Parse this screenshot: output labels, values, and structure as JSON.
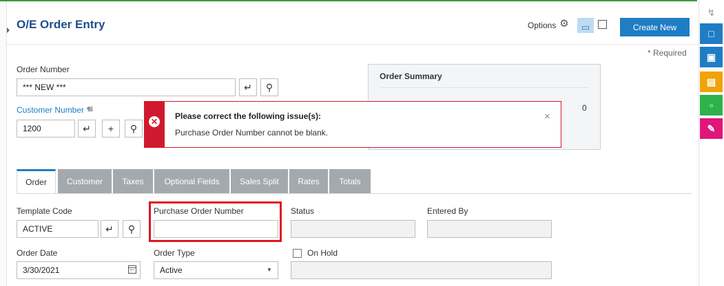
{
  "header": {
    "title": "O/E Order Entry",
    "options_label": "Options",
    "create_new_label": "Create New",
    "required_text": "Required"
  },
  "order_number": {
    "label": "Order Number",
    "value": "*** NEW ***"
  },
  "customer_number": {
    "label": "Customer Number",
    "value": "1200"
  },
  "order_summary": {
    "title": "Order Summary",
    "value": "0"
  },
  "alert": {
    "title": "Please correct the following issue(s):",
    "message": "Purchase Order Number cannot be blank."
  },
  "tabs": [
    {
      "label": "Order",
      "active": true
    },
    {
      "label": "Customer"
    },
    {
      "label": "Taxes"
    },
    {
      "label": "Optional Fields"
    },
    {
      "label": "Sales Split"
    },
    {
      "label": "Rates"
    },
    {
      "label": "Totals"
    }
  ],
  "form": {
    "template_code": {
      "label": "Template Code",
      "value": "ACTIVE"
    },
    "purchase_order_number": {
      "label": "Purchase Order Number",
      "value": ""
    },
    "status": {
      "label": "Status",
      "value": ""
    },
    "entered_by": {
      "label": "Entered By",
      "value": ""
    },
    "order_date": {
      "label": "Order Date",
      "value": "3/30/2021"
    },
    "order_type": {
      "label": "Order Type",
      "value": "Active"
    },
    "on_hold": {
      "label": "On Hold",
      "checked": false
    }
  },
  "right_rail": [
    {
      "icon": "lightning-icon",
      "color": "#ffffff"
    },
    {
      "icon": "window-1-icon",
      "color": "#1f7dc4"
    },
    {
      "icon": "window-clock-icon",
      "color": "#1f7dc4"
    },
    {
      "icon": "report-icon",
      "color": "#f0a30a"
    },
    {
      "icon": "document-icon",
      "color": "#2fb14a"
    },
    {
      "icon": "pen-icon",
      "color": "#e0167a"
    }
  ]
}
